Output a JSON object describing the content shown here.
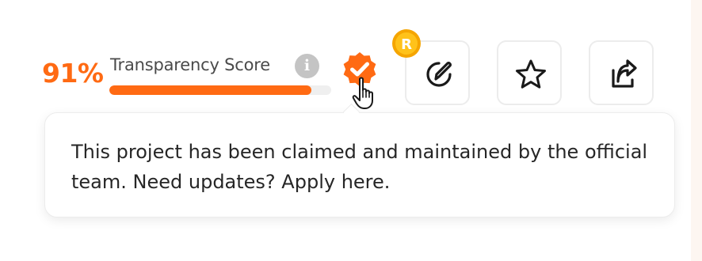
{
  "score": {
    "value_text": "91%",
    "label": "Transparency Score",
    "progress_fraction": 0.91,
    "info_icon": "info-icon"
  },
  "colors": {
    "accent": "#ff6a13",
    "track": "#efefef",
    "coin": "#f5a500",
    "button_border": "#ececec"
  },
  "badge": {
    "icon": "verified-check-icon",
    "coin_letter": "R"
  },
  "actions": [
    {
      "icon": "edit-icon"
    },
    {
      "icon": "star-icon"
    },
    {
      "icon": "share-icon"
    }
  ],
  "tooltip": {
    "text": "This project has been claimed and maintained by the official team. Need updates? Apply here."
  }
}
